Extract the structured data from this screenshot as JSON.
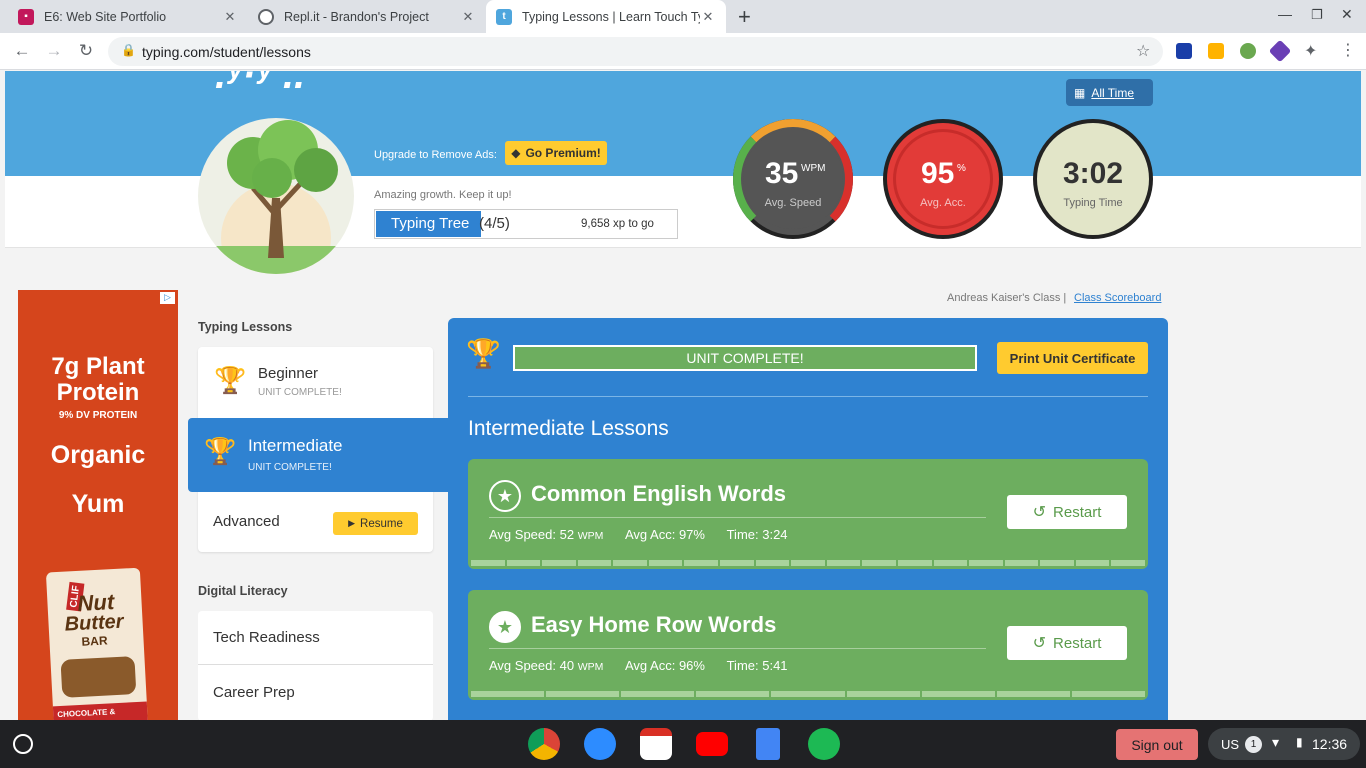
{
  "browser": {
    "tabs": [
      {
        "title": "E6: Web Site Portfolio",
        "favicon": "slides-icon",
        "color": "#c2185b"
      },
      {
        "title": "Repl.it - Brandon's Project",
        "favicon": "replit-icon",
        "color": "#5f6368"
      },
      {
        "title": "Typing Lessons | Learn Touch Ty",
        "favicon": "typing-icon",
        "color": "#4fa6dd"
      }
    ],
    "new_tab": "+",
    "url": "typing.com/student/lessons"
  },
  "header": {
    "all_time": "All Time",
    "upgrade_text": "Upgrade to Remove Ads:",
    "premium_label": "Go Premium!",
    "growth_text": "Amazing growth. Keep it up!",
    "tree_label": "Typing Tree",
    "tree_level": "(4/5)",
    "tree_progress": 0.35,
    "xp_to_go": "9,658 xp to go"
  },
  "stats": {
    "speed_value": "35",
    "speed_unit": "WPM",
    "speed_label": "Avg. Speed",
    "acc_value": "95",
    "acc_unit": "%",
    "acc_label": "Avg. Acc.",
    "time_value": "3:02",
    "time_label": "Typing Time"
  },
  "ad": {
    "line1": "7g Plant",
    "line2": "Protein",
    "line3": "9% DV PROTEIN",
    "line4": "Organic",
    "line5": "Yum",
    "brand": "CLIF",
    "product1": "Nut",
    "product2": "Butter",
    "product3": "BAR",
    "flavor": "CHOCOLATE &"
  },
  "class_info": {
    "class_name": "Andreas Kaiser's Class |",
    "scoreboard": "Class Scoreboard"
  },
  "sidebar": {
    "section1": "Typing Lessons",
    "beginner": {
      "title": "Beginner",
      "status": "UNIT COMPLETE!"
    },
    "intermediate": {
      "title": "Intermediate",
      "status": "UNIT COMPLETE!"
    },
    "advanced": {
      "title": "Advanced",
      "action": "Resume"
    },
    "section2": "Digital Literacy",
    "items": [
      "Tech Readiness",
      "Career Prep"
    ]
  },
  "main": {
    "unit_status": "UNIT COMPLETE!",
    "certificate": "Print Unit Certificate",
    "heading": "Intermediate Lessons",
    "lessons": [
      {
        "title": "Common English Words",
        "speed": "Avg Speed: 52",
        "unit": "WPM",
        "acc": "Avg Acc: 97%",
        "time": "Time: 3:24",
        "action": "Restart"
      },
      {
        "title": "Easy Home Row Words",
        "speed": "Avg Speed: 40",
        "unit": "WPM",
        "acc": "Avg Acc: 96%",
        "time": "Time: 5:41",
        "action": "Restart"
      }
    ]
  },
  "taskbar": {
    "signout": "Sign out",
    "locale": "US",
    "notifications": "1",
    "clock": "12:36"
  }
}
